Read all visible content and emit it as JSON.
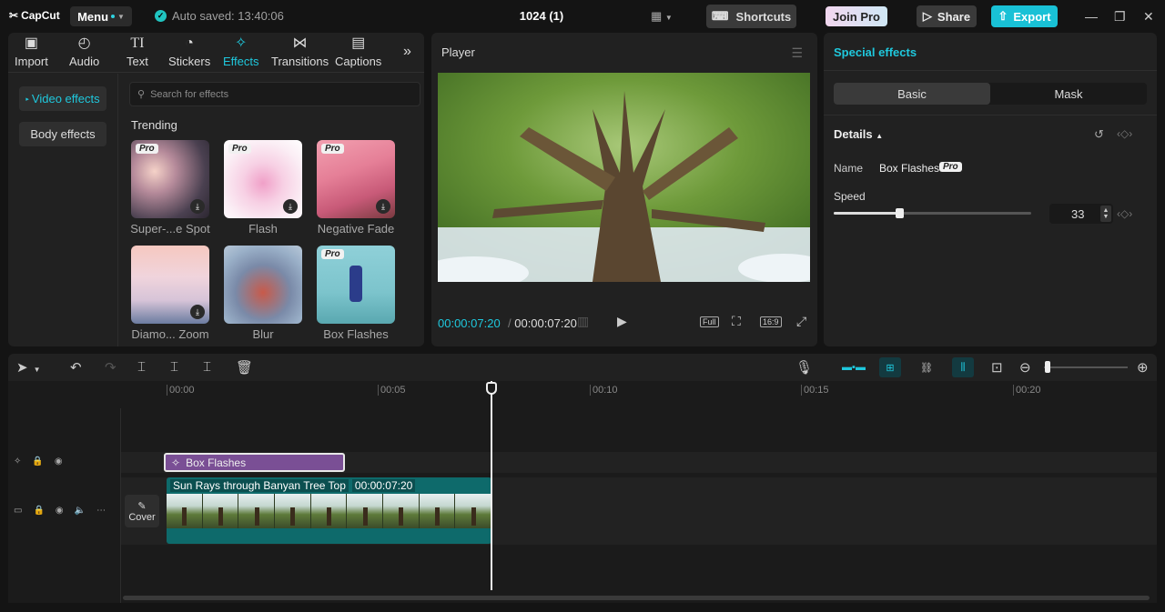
{
  "topbar": {
    "logo": "CapCut",
    "menu_label": "Menu",
    "saved_status": "Auto saved: 13:40:06",
    "project_name": "1024 (1)",
    "shortcuts_label": "Shortcuts",
    "join_pro_label": "Join Pro",
    "share_label": "Share",
    "export_label": "Export"
  },
  "media_tabs": [
    {
      "label": "Import",
      "icon": "import-icon"
    },
    {
      "label": "Audio",
      "icon": "audio-icon"
    },
    {
      "label": "Text",
      "icon": "text-icon"
    },
    {
      "label": "Stickers",
      "icon": "stickers-icon"
    },
    {
      "label": "Effects",
      "icon": "effects-icon",
      "active": true
    },
    {
      "label": "Transitions",
      "icon": "transitions-icon"
    },
    {
      "label": "Captions",
      "icon": "captions-icon"
    }
  ],
  "effect_categories": [
    {
      "label": "Video effects",
      "active": true
    },
    {
      "label": "Body effects"
    }
  ],
  "search": {
    "placeholder": "Search for effects"
  },
  "trending_label": "Trending",
  "effects_grid": [
    {
      "name": "Super-...e Spot",
      "pro": true,
      "download": true
    },
    {
      "name": "Flash",
      "pro": true,
      "download": true
    },
    {
      "name": "Negative Fade",
      "pro": true,
      "download": true
    },
    {
      "name": "Diamo... Zoom",
      "pro": false,
      "download": true
    },
    {
      "name": "Blur",
      "pro": false,
      "download": false
    },
    {
      "name": "Box Flashes",
      "pro": true,
      "download": false
    }
  ],
  "pro_badge": "Pro",
  "player": {
    "title": "Player",
    "current_time": "00:00:07:20",
    "total_time": "00:00:07:20",
    "full_label": "Full",
    "ratio_label": "16:9"
  },
  "special_effects": {
    "title": "Special effects",
    "tab_basic": "Basic",
    "tab_mask": "Mask",
    "details_label": "Details",
    "name_label": "Name",
    "name_value": "Box Flashes",
    "speed_label": "Speed",
    "speed_value": "33",
    "speed_fraction": 0.33
  },
  "timeline": {
    "ruler": [
      "00:00",
      "00:05",
      "00:10",
      "00:15",
      "00:20"
    ],
    "effect_clip_label": "Box Flashes",
    "video_clip_name": "Sun Rays through Banyan Tree Top",
    "video_clip_duration": "00:00:07:20",
    "cover_label": "Cover"
  },
  "colors": {
    "accent": "#1fc8dd",
    "effect_clip": "#7a4f95",
    "video_clip": "#0e6a6b"
  }
}
